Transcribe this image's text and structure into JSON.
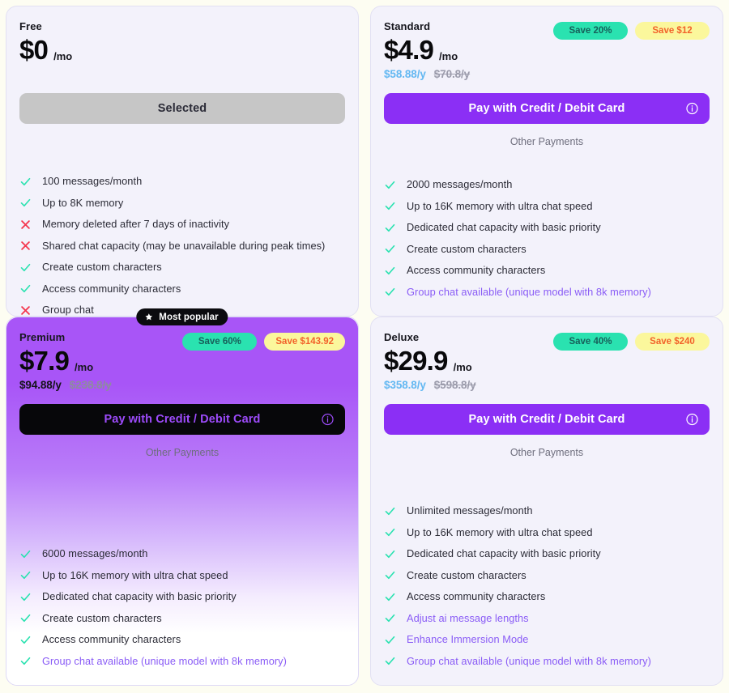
{
  "theme": {
    "page_bg": "#fdfdf2",
    "card_bg": "#f3f2fb",
    "accent_purple": "#8b2ff5",
    "badge_green_bg": "#2ae2b0",
    "badge_yellow_bg": "#fbf79c",
    "badge_yellow_text": "#f2622a",
    "yearly_blue": "#63b8f2",
    "check_green": "#2ae2b0",
    "cross_red": "#f43f5e",
    "feature_accent": "#8a5cf6"
  },
  "labels": {
    "other_payments": "Other Payments",
    "most_popular": "Most popular",
    "per_month_suffix": "/mo",
    "info_icon": "info-circle-icon",
    "star_icon": "star-icon",
    "check_icon": "check-icon",
    "cross_icon": "cross-icon"
  },
  "plans": [
    {
      "id": "free",
      "name": "Free",
      "price": "$0",
      "per": "/mo",
      "yearly_now": "",
      "yearly_was": "",
      "badges": [],
      "cta": {
        "label": "Selected",
        "style": "selected",
        "has_info": false
      },
      "other_payments": "",
      "features": [
        {
          "icon": "check",
          "text": "100 messages/month",
          "accent": false
        },
        {
          "icon": "check",
          "text": "Up to 8K memory",
          "accent": false
        },
        {
          "icon": "cross",
          "text": "Memory deleted after 7 days of inactivity",
          "accent": false
        },
        {
          "icon": "cross",
          "text": "Shared chat capacity (may be unavailable during peak times)",
          "accent": false
        },
        {
          "icon": "check",
          "text": "Create custom characters",
          "accent": false
        },
        {
          "icon": "check",
          "text": "Access community characters",
          "accent": false
        },
        {
          "icon": "cross",
          "text": "Group chat",
          "accent": false
        }
      ]
    },
    {
      "id": "standard",
      "name": "Standard",
      "price": "$4.9",
      "per": "/mo",
      "yearly_now": "$58.88/y",
      "yearly_was": "$70.8/y",
      "badges": [
        {
          "text": "Save 20%",
          "style": "green"
        },
        {
          "text": "Save $12",
          "style": "yellow"
        }
      ],
      "cta": {
        "label": "Pay with Credit / Debit Card",
        "style": "pay",
        "has_info": true
      },
      "other_payments": "Other Payments",
      "features": [
        {
          "icon": "check",
          "text": "2000 messages/month",
          "accent": false
        },
        {
          "icon": "check",
          "text": "Up to 16K memory with ultra chat speed",
          "accent": false
        },
        {
          "icon": "check",
          "text": "Dedicated chat capacity with basic priority",
          "accent": false
        },
        {
          "icon": "check",
          "text": "Create custom characters",
          "accent": false
        },
        {
          "icon": "check",
          "text": "Access community characters",
          "accent": false
        },
        {
          "icon": "check",
          "text": "Group chat available (unique model with 8k memory)",
          "accent": true
        }
      ]
    },
    {
      "id": "premium",
      "name": "Premium",
      "price": "$7.9",
      "per": "/mo",
      "yearly_now": "$94.88/y",
      "yearly_was": "$238.8/y",
      "ribbon": "Most popular",
      "badges": [
        {
          "text": "Save 60%",
          "style": "green"
        },
        {
          "text": "Save $143.92",
          "style": "yellow"
        }
      ],
      "cta": {
        "label": "Pay with Credit / Debit Card",
        "style": "pay-dark",
        "has_info": true
      },
      "other_payments": "Other Payments",
      "features": [
        {
          "icon": "check",
          "text": "6000 messages/month",
          "accent": false
        },
        {
          "icon": "check",
          "text": "Up to 16K memory with ultra chat speed",
          "accent": false
        },
        {
          "icon": "check",
          "text": "Dedicated chat capacity with basic priority",
          "accent": false
        },
        {
          "icon": "check",
          "text": "Create custom characters",
          "accent": false
        },
        {
          "icon": "check",
          "text": "Access community characters",
          "accent": false
        },
        {
          "icon": "check",
          "text": "Group chat available (unique model with 8k memory)",
          "accent": true
        }
      ]
    },
    {
      "id": "deluxe",
      "name": "Deluxe",
      "price": "$29.9",
      "per": "/mo",
      "yearly_now": "$358.8/y",
      "yearly_was": "$598.8/y",
      "badges": [
        {
          "text": "Save 40%",
          "style": "green"
        },
        {
          "text": "Save $240",
          "style": "yellow"
        }
      ],
      "cta": {
        "label": "Pay with Credit / Debit Card",
        "style": "pay",
        "has_info": true
      },
      "other_payments": "Other Payments",
      "features": [
        {
          "icon": "check",
          "text": "Unlimited messages/month",
          "accent": false
        },
        {
          "icon": "check",
          "text": "Up to 16K memory with ultra chat speed",
          "accent": false
        },
        {
          "icon": "check",
          "text": "Dedicated chat capacity with basic priority",
          "accent": false
        },
        {
          "icon": "check",
          "text": "Create custom characters",
          "accent": false
        },
        {
          "icon": "check",
          "text": "Access community characters",
          "accent": false
        },
        {
          "icon": "check",
          "text": "Adjust ai message lengths",
          "accent": true
        },
        {
          "icon": "check",
          "text": "Enhance Immersion Mode",
          "accent": true
        },
        {
          "icon": "check",
          "text": "Group chat available (unique model with 8k memory)",
          "accent": true
        }
      ]
    }
  ]
}
